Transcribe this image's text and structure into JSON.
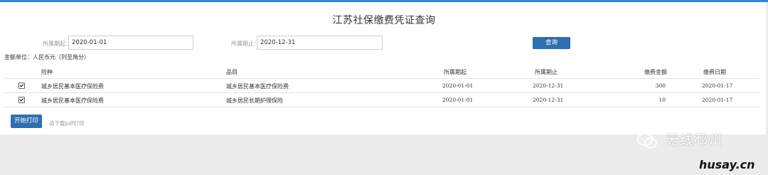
{
  "page": {
    "title": "江苏社保缴费凭证查询"
  },
  "filters": {
    "start_label": "所属期起：",
    "start_value": "2020-01-01",
    "end_label": "所属期止：",
    "end_value": "2020-12-31",
    "query_button": "查询"
  },
  "unit_text": "金额单位：人民币元（列至角分）",
  "table": {
    "headers": [
      "险种",
      "品目",
      "所属期起",
      "所属期止",
      "缴费金额",
      "缴费日期"
    ],
    "rows": [
      [
        "城乡居民基本医疗保险费",
        "城乡居民基本医疗保险费",
        "2020-01-01",
        "2020-12-31",
        "300",
        "2020-01-17"
      ],
      [
        "城乡居民基本医疗保险费",
        "城乡居民长期护理保险",
        "2020-01-01",
        "2020-12-31",
        "10",
        "2020-01-17"
      ]
    ]
  },
  "actions": {
    "print_button": "开始打印",
    "download_link": "请下载pdf打印"
  },
  "watermark": {
    "brand": "无线邳州",
    "site": "husay.cn",
    "icon": "wechat-icon"
  },
  "colors": {
    "accent": "#2e6fb0",
    "topbar": "#3a84d6",
    "background": "#ececec"
  }
}
